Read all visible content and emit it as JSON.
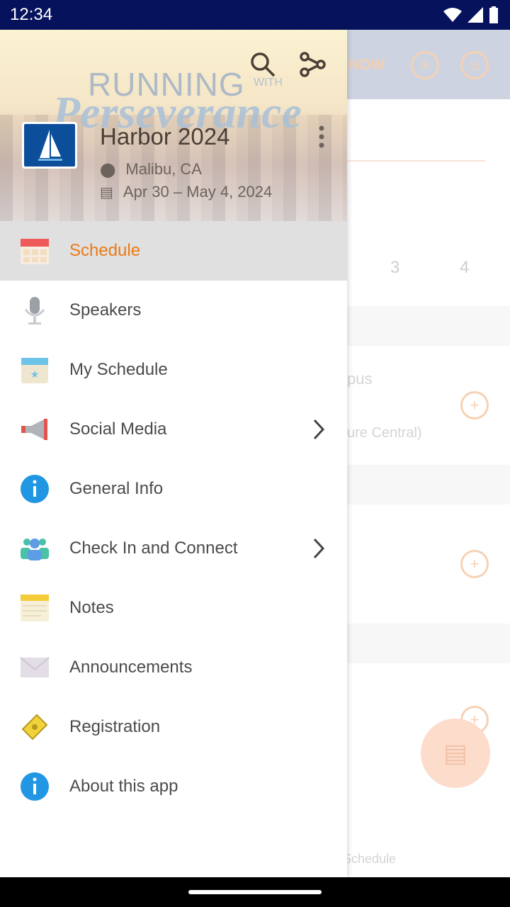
{
  "status_bar": {
    "time": "12:34"
  },
  "drawer": {
    "header": {
      "banner_text": "RUNNING WITH Perseverance",
      "event_title": "Harbor 2024",
      "location": "Malibu, CA",
      "dates": "Apr 30 – May 4, 2024",
      "icons": [
        "search-icon",
        "share-icon",
        "more-vert-icon"
      ]
    },
    "items": [
      {
        "label": "Schedule",
        "icon": "calendar-icon",
        "active": true
      },
      {
        "label": "Speakers",
        "icon": "microphone-icon"
      },
      {
        "label": "My Schedule",
        "icon": "my-schedule-icon"
      },
      {
        "label": "Social Media",
        "icon": "megaphone-icon",
        "has_submenu": true
      },
      {
        "label": "General Info",
        "icon": "info-icon"
      },
      {
        "label": "Check In and Connect",
        "icon": "people-icon",
        "has_submenu": true
      },
      {
        "label": "Notes",
        "icon": "notes-icon"
      },
      {
        "label": "Announcements",
        "icon": "envelope-icon"
      },
      {
        "label": "Registration",
        "icon": "ticket-icon"
      },
      {
        "label": "About this app",
        "icon": "info-icon"
      }
    ],
    "accent": "#ec7a16"
  },
  "background": {
    "now_label": "NOW",
    "days": [
      "3",
      "4"
    ],
    "ghost_text_1": "pus",
    "ghost_text_2": "ure Central)",
    "tab_label": "Schedule"
  }
}
